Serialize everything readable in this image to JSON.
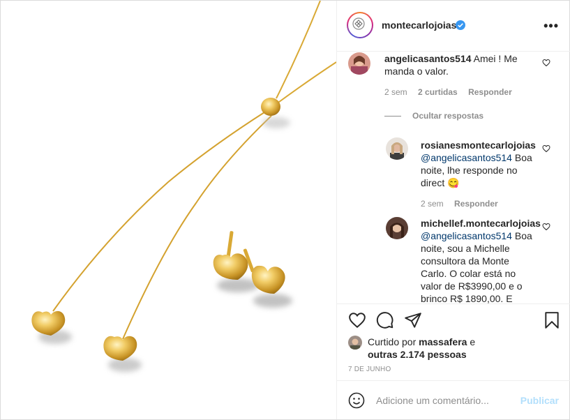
{
  "post": {
    "username": "montecarlojoias",
    "verified": true,
    "more_label": "•••"
  },
  "comments": [
    {
      "username": "angelicasantos514",
      "text": "Amei ! Me manda o valor.",
      "time": "2 sem",
      "likes": "2 curtidas",
      "reply_label": "Responder"
    }
  ],
  "hide_replies_label": "Ocultar respostas",
  "replies": [
    {
      "username": "rosianesmontecarlojoias",
      "mention": "@angelicasantos514",
      "text_lines": [
        "Boa",
        "noite, lhe responde no",
        "direct 😋"
      ],
      "time": "2 sem",
      "reply_label": "Responder"
    },
    {
      "username": "michellef.montecarlojoias",
      "mention": "@angelicasantos514",
      "text_lines": [
        "Boa",
        "noite, sou a Michelle",
        "consultora da Monte",
        "Carlo. O colar está no",
        "valor de R$3990,00 e o",
        "brinco R$ 1890,00. E"
      ]
    }
  ],
  "likes": {
    "prefix": "Curtido por",
    "user": "massafera",
    "conj": "e",
    "others": "outras 2.174 pessoas"
  },
  "date": "7 DE JUNHO",
  "add_comment": {
    "placeholder": "Adicione um comentário...",
    "publish_label": "Publicar"
  },
  "colors": {
    "link": "#00376b",
    "secondary": "#8e8e8e",
    "publish_disabled": "#b2dffc",
    "verified": "#3897f0",
    "gold": "#d9a935"
  }
}
